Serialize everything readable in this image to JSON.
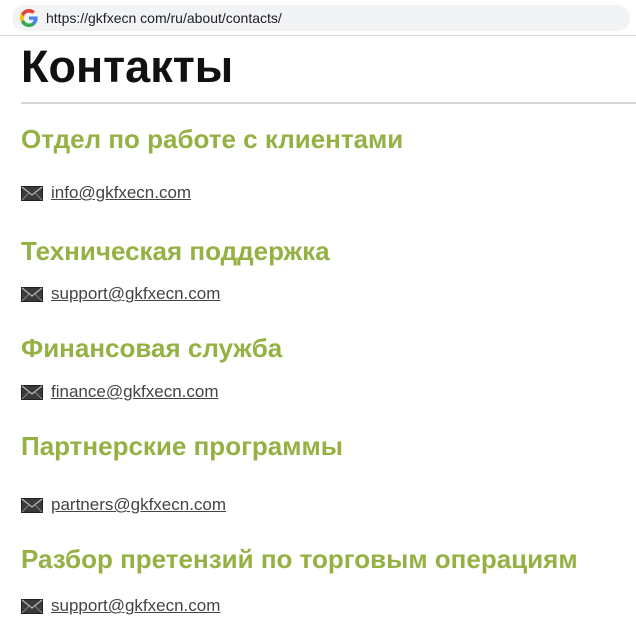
{
  "browser": {
    "url": "https://gkfxecn com/ru/about/contacts/",
    "favicon": "google-g-icon"
  },
  "page": {
    "title": "Контакты"
  },
  "colors": {
    "section_title": "#95b144",
    "heading": "#111111",
    "link": "#444444"
  },
  "sections": [
    {
      "title": "Отдел по работе с клиентами",
      "email": "info@gkfxecn.com"
    },
    {
      "title": "Техническая поддержка",
      "email": "support@gkfxecn.com"
    },
    {
      "title": "Финансовая служба",
      "email": "finance@gkfxecn.com"
    },
    {
      "title": "Партнерские программы",
      "email": "partners@gkfxecn.com"
    },
    {
      "title": "Разбор претензий по торговым операциям",
      "email": "support@gkfxecn.com"
    }
  ],
  "icons": {
    "email": "envelope-icon"
  }
}
